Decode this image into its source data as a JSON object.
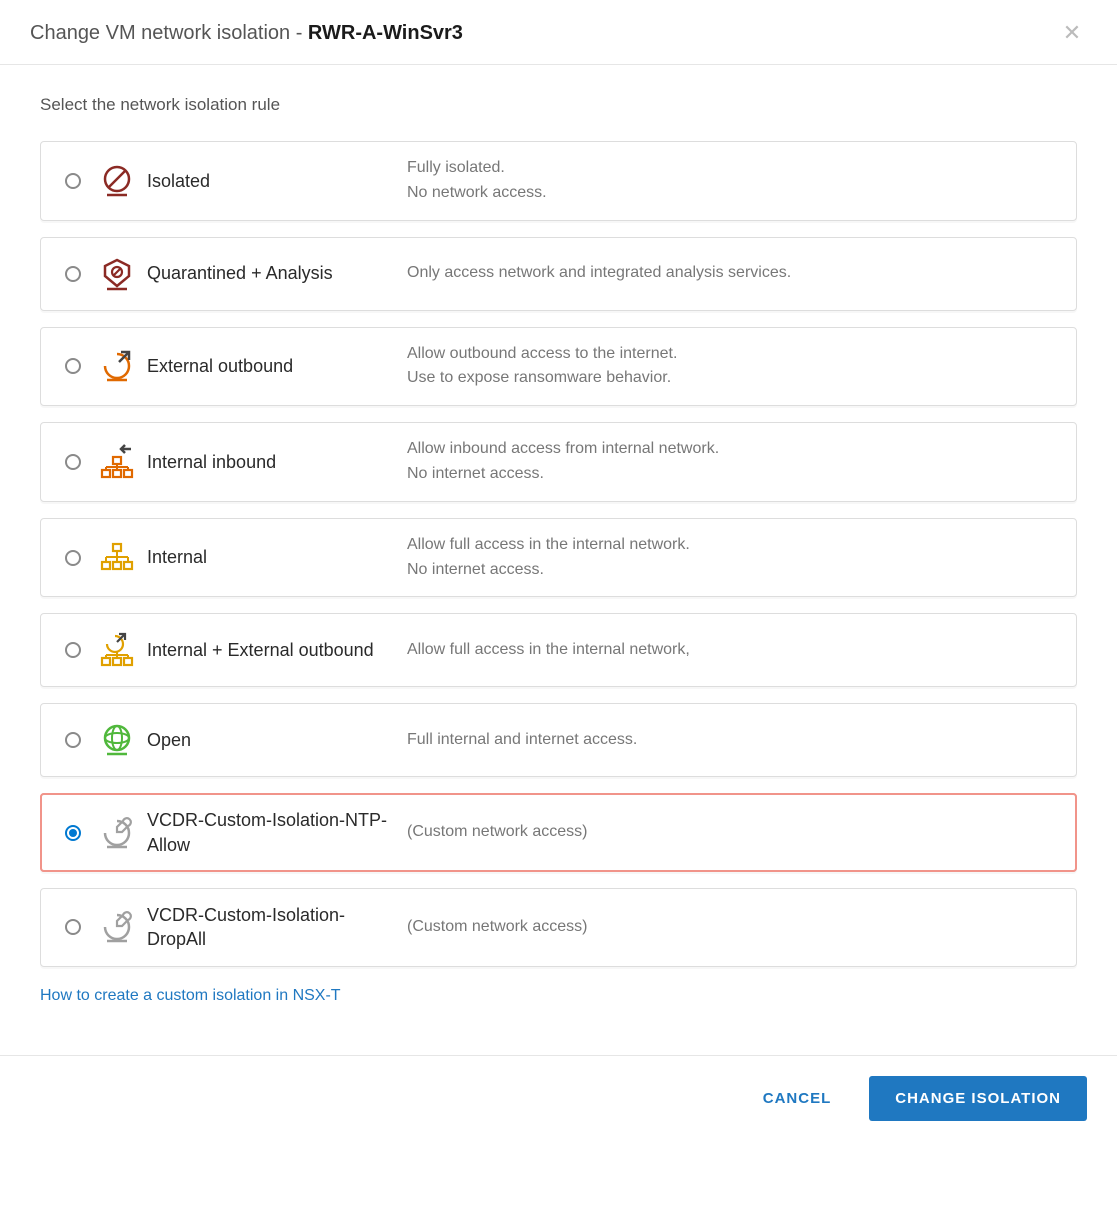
{
  "header": {
    "title_prefix": "Change VM network isolation - ",
    "vm_name": "RWR-A-WinSvr3"
  },
  "prompt": "Select the network isolation rule",
  "options": [
    {
      "id": "isolated",
      "label": "Isolated",
      "desc": "Fully isolated.\nNo network access.",
      "icon": "isolated-icon",
      "selected": false,
      "highlight": false
    },
    {
      "id": "quarantined",
      "label": "Quarantined + Analysis",
      "desc": "Only access network and integrated analysis services.",
      "icon": "quarantined-icon",
      "selected": false,
      "highlight": false
    },
    {
      "id": "external-outbound",
      "label": "External outbound",
      "desc": "Allow outbound access to the internet.\nUse to expose ransomware behavior.",
      "icon": "external-outbound-icon",
      "selected": false,
      "highlight": false
    },
    {
      "id": "internal-inbound",
      "label": "Internal inbound",
      "desc": "Allow inbound access from internal network.\nNo internet access.",
      "icon": "internal-inbound-icon",
      "selected": false,
      "highlight": false
    },
    {
      "id": "internal",
      "label": "Internal",
      "desc": "Allow full access in the internal network.\nNo internet access.",
      "icon": "internal-icon",
      "selected": false,
      "highlight": false
    },
    {
      "id": "internal-external-outbound",
      "label": "Internal + External outbound",
      "desc": "Allow full access in the internal network,",
      "icon": "internal-external-outbound-icon",
      "selected": false,
      "highlight": false
    },
    {
      "id": "open",
      "label": "Open",
      "desc": "Full internal and internet access.",
      "icon": "open-icon",
      "selected": false,
      "highlight": false
    },
    {
      "id": "custom-ntp-allow",
      "label": "VCDR-Custom-Isolation-NTP-Allow",
      "desc": "(Custom network access)",
      "icon": "custom-icon",
      "selected": true,
      "highlight": true
    },
    {
      "id": "custom-dropall",
      "label": "VCDR-Custom-Isolation-DropAll",
      "desc": "(Custom network access)",
      "icon": "custom-icon",
      "selected": false,
      "highlight": false
    }
  ],
  "help_link": "How to create a custom isolation in NSX-T",
  "footer": {
    "cancel": "CANCEL",
    "confirm": "CHANGE ISOLATION"
  },
  "colors": {
    "dark_red": "#8b2a24",
    "orange": "#e06900",
    "amber": "#e0a000",
    "green": "#50b83c",
    "gray": "#a0a0a0",
    "primary": "#1f78c1"
  }
}
